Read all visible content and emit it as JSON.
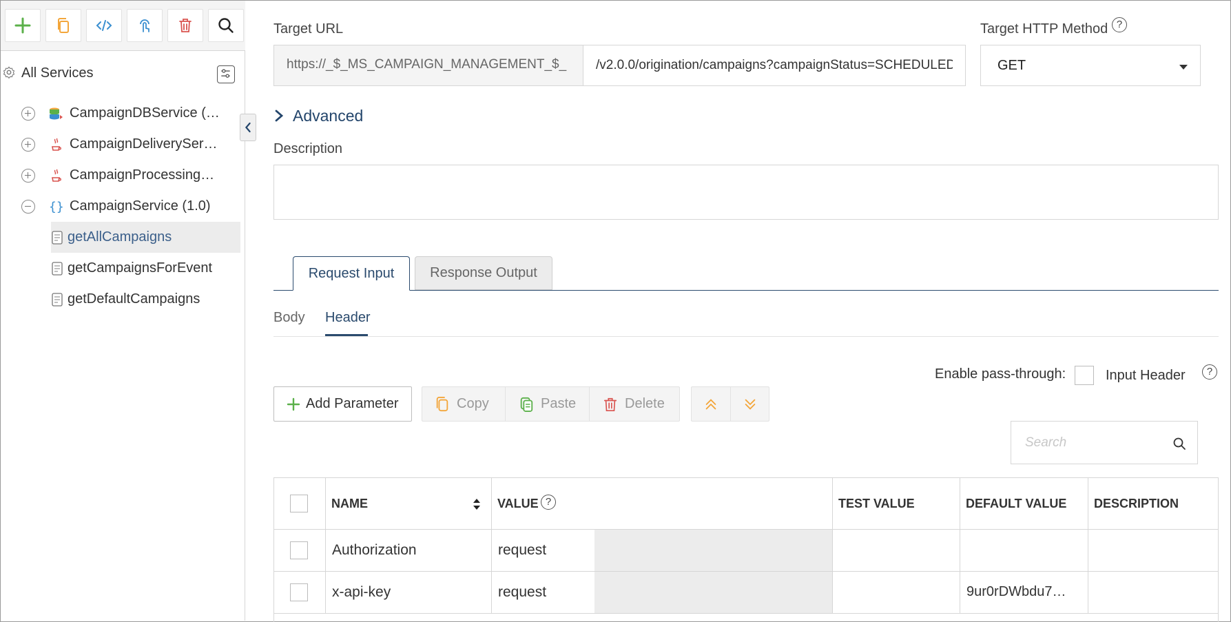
{
  "colors": {
    "accent": "#2a4a6d",
    "add_green": "#5bb04a",
    "copy_orange": "#f3a63b",
    "delete_red": "#d9534f",
    "code_blue": "#3a8fd0"
  },
  "toolbar": {
    "buttons": [
      {
        "icon": "plus-icon"
      },
      {
        "icon": "copy-icon"
      },
      {
        "icon": "code-icon"
      },
      {
        "icon": "touch-icon"
      },
      {
        "icon": "trash-icon"
      },
      {
        "icon": "search-icon"
      }
    ]
  },
  "tree": {
    "root_label": "All Services",
    "services": [
      {
        "label": "CampaignDBService (…",
        "icon": "database-service-icon",
        "expanded": false
      },
      {
        "label": "CampaignDeliveryServ…",
        "icon": "java-service-icon",
        "expanded": false
      },
      {
        "label": "CampaignProcessingS…",
        "icon": "java-service-icon",
        "expanded": false
      },
      {
        "label": "CampaignService (1.0)",
        "icon": "rest-service-icon",
        "expanded": true
      }
    ],
    "operations": [
      {
        "label": "getAllCampaigns",
        "selected": true
      },
      {
        "label": "getCampaignsForEvent",
        "selected": false
      },
      {
        "label": "getDefaultCampaigns",
        "selected": false
      }
    ]
  },
  "form": {
    "target_url_label": "Target URL",
    "url_prefix": "https://_$_MS_CAMPAIGN_MANAGEMENT_$_",
    "url_path": "/v2.0.0/origination/campaigns?campaignStatus=SCHEDULED",
    "method_label": "Target HTTP Method",
    "method_value": "GET",
    "help_glyph": "?",
    "advanced_label": "Advanced",
    "description_label": "Description",
    "description_value": ""
  },
  "tabs": {
    "request": "Request Input",
    "response": "Response Output",
    "active": "request"
  },
  "subtabs": {
    "body": "Body",
    "header": "Header",
    "active": "header"
  },
  "passthrough": {
    "label": "Enable pass-through:",
    "option_label": "Input Header",
    "checked": false
  },
  "actions": {
    "add": "Add Parameter",
    "copy": "Copy",
    "paste": "Paste",
    "delete": "Delete"
  },
  "search": {
    "placeholder": "Search"
  },
  "grid": {
    "columns": {
      "name": "NAME",
      "value": "VALUE",
      "test_value": "TEST VALUE",
      "default_value": "DEFAULT VALUE",
      "description": "DESCRIPTION"
    },
    "rows": [
      {
        "name": "Authorization",
        "value": "request",
        "test_value": "",
        "default_value": "",
        "description": ""
      },
      {
        "name": "x-api-key",
        "value": "request",
        "test_value": "",
        "default_value": "9ur0rDWbdu7…",
        "description": ""
      }
    ]
  }
}
